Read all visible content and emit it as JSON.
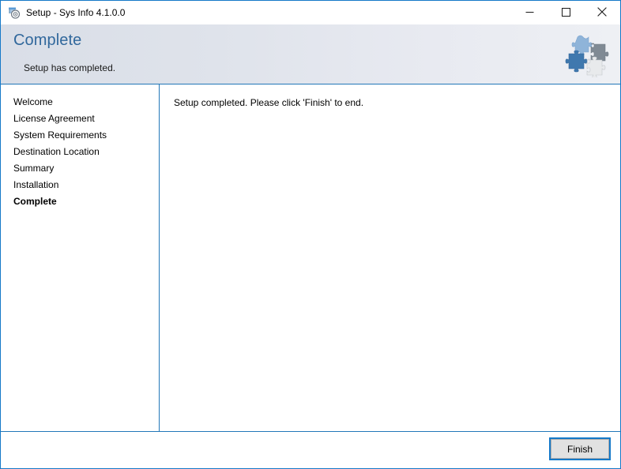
{
  "window": {
    "title": "Setup - Sys Info 4.1.0.0",
    "icon": "installer-icon",
    "border_color": "#1579c8",
    "controls": [
      {
        "name": "minimize",
        "glyph": "minimize-icon"
      },
      {
        "name": "maximize",
        "glyph": "maximize-icon"
      },
      {
        "name": "close",
        "glyph": "close-icon"
      }
    ]
  },
  "header": {
    "title": "Complete",
    "subtitle": "Setup has completed.",
    "title_color": "#31689c",
    "graphic": "puzzle-pieces-icon",
    "divider_color": "#2277b8"
  },
  "sidebar": {
    "steps": [
      {
        "label": "Welcome",
        "current": false
      },
      {
        "label": "License Agreement",
        "current": false
      },
      {
        "label": "System Requirements",
        "current": false
      },
      {
        "label": "Destination Location",
        "current": false
      },
      {
        "label": "Summary",
        "current": false
      },
      {
        "label": "Installation",
        "current": false
      },
      {
        "label": "Complete",
        "current": true
      }
    ]
  },
  "content": {
    "message": "Setup completed. Please click 'Finish' to end."
  },
  "footer": {
    "finish_label": "Finish",
    "focus_color": "#1579c8"
  }
}
